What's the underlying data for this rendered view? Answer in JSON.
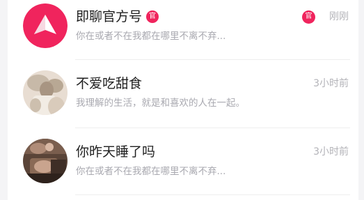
{
  "colors": {
    "accent": "#f0245d",
    "title_text": "#1f1f1f",
    "preview_text": "#a9a9b0",
    "time_text": "#b3b3b8"
  },
  "conversations": [
    {
      "name": "即聊官方号",
      "official_badge": "官",
      "preview": "你在或者不在我都在哪里不离不弃...",
      "time": "刚刚",
      "time_badge": "官",
      "avatar_icon": "paper-plane-icon"
    },
    {
      "name": "不爱吃甜食",
      "preview": "我理解的生活，就是和喜欢的人在一起。",
      "time": "3小时前",
      "avatar_icon": "user-photo-avatar"
    },
    {
      "name": "你昨天睡了吗",
      "preview": "你在或者不在我都在哪里不离不弃...",
      "time": "3小时前",
      "avatar_icon": "user-photo-avatar"
    }
  ]
}
